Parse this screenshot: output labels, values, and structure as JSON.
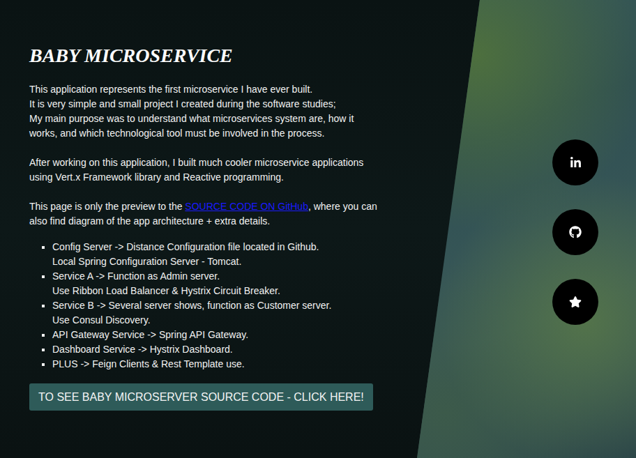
{
  "title": "BABY MICROSERVICE",
  "intro": {
    "lines": [
      "This application represents the first microservice I have ever built.",
      "It is very simple and small project I created during the software studies;",
      "My main purpose was to understand what microservices system are, how it works, and which technological tool must be involved in the process."
    ]
  },
  "paragraph": "After working on this application, I built much cooler microservice applications using Vert.x Framework library and Reactive programming.",
  "preview": {
    "before": "This page is only the preview to the ",
    "link": "SOURCE CODE ON GitHub",
    "after": ", where you can also find diagram of the app architecture + extra details."
  },
  "features": [
    {
      "lines": [
        "Config Server -> Distance Configuration file located in Github.",
        "Local Spring Configuration Server - Tomcat."
      ]
    },
    {
      "lines": [
        "Service A -> Function as Admin server.",
        "Use Ribbon Load Balancer & Hystrix Circuit Breaker."
      ]
    },
    {
      "lines": [
        "Service B -> Several server shows, function as Customer server.",
        "Use Consul Discovery."
      ]
    },
    {
      "lines": [
        "API Gateway Service -> Spring API Gateway."
      ]
    },
    {
      "lines": [
        "Dashboard Service -> Hystrix Dashboard."
      ]
    },
    {
      "lines": [
        "PLUS -> Feign Clients & Rest Template use."
      ]
    }
  ],
  "button": {
    "label": "TO SEE BABY MICROSERVER SOURCE CODE - CLICK HERE!"
  },
  "social": [
    {
      "kind": "linkedin"
    },
    {
      "kind": "github"
    },
    {
      "kind": "star"
    }
  ]
}
